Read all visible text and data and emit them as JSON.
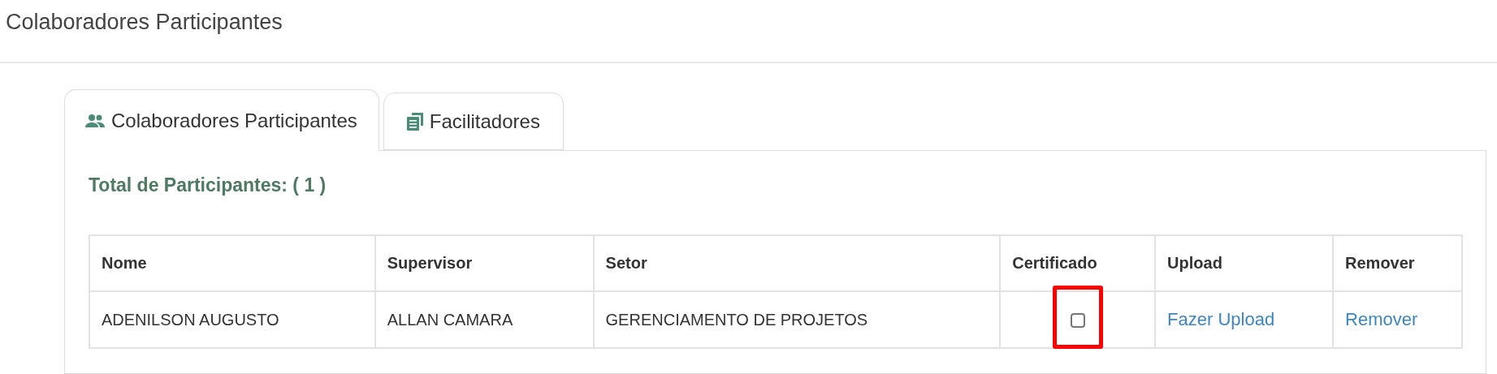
{
  "page_title": "Colaboradores Participantes",
  "tabs": [
    {
      "label": "Colaboradores Participantes",
      "selected": true
    },
    {
      "label": "Facilitadores",
      "selected": false
    }
  ],
  "total_label": "Total de Participantes: ( 1 )",
  "table": {
    "columns": [
      "Nome",
      "Supervisor",
      "Setor",
      "Certificado",
      "Upload",
      "Remover"
    ],
    "rows": [
      {
        "nome": "ADENILSON AUGUSTO",
        "supervisor": "ALLAN CAMARA",
        "setor": "GERENCIAMENTO DE PROJETOS",
        "certificado": {
          "checked": false,
          "highlighted": true
        },
        "upload": "Fazer Upload",
        "remover": "Remover"
      }
    ]
  }
}
